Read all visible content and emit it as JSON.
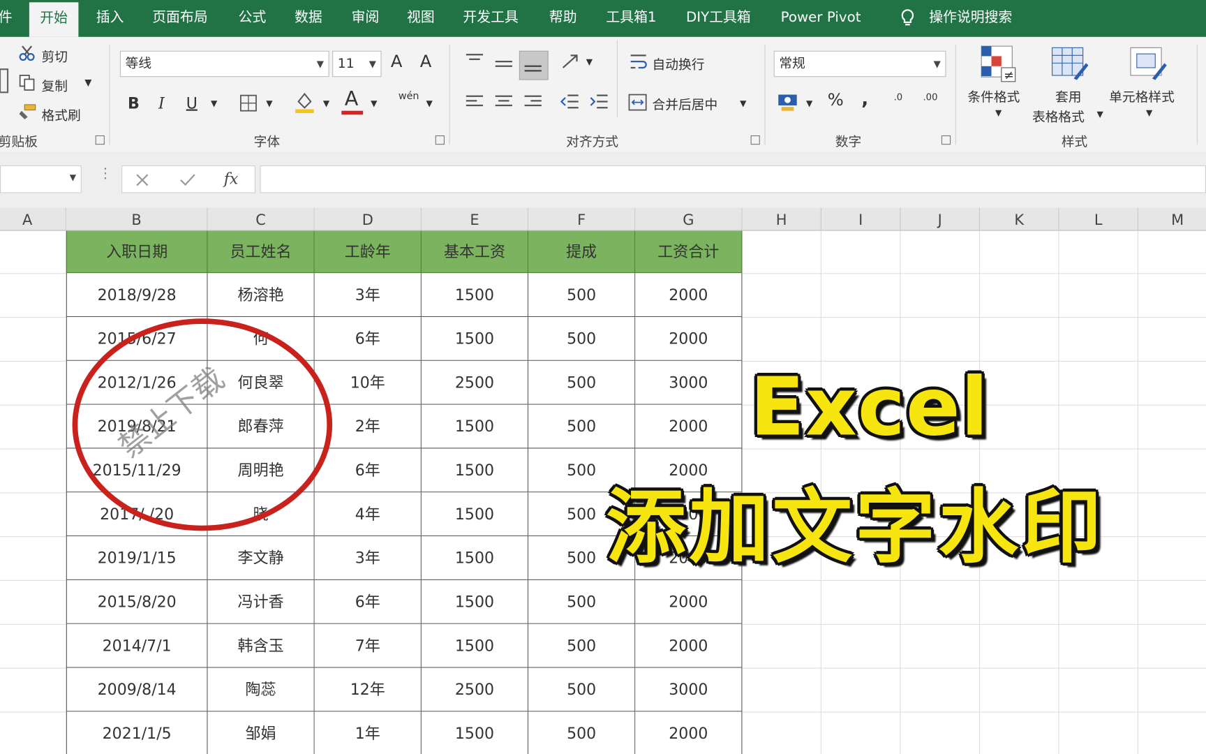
{
  "menu": {
    "file_partial": "件",
    "tabs": [
      "开始",
      "插入",
      "页面布局",
      "公式",
      "数据",
      "审阅",
      "视图",
      "开发工具",
      "帮助",
      "工具箱1",
      "DIY工具箱",
      "Power Pivot"
    ],
    "search": "操作说明搜索"
  },
  "ribbon": {
    "clipboard": {
      "cut": "剪切",
      "copy": "复制",
      "painter": "格式刷",
      "label": "剪贴板"
    },
    "font": {
      "name": "等线",
      "size": "11",
      "bold": "B",
      "italic": "I",
      "underline": "U",
      "grow": "A",
      "shrink": "A",
      "color_a": "A",
      "phonetic": "wén",
      "label": "字体",
      "font_color": "#e02020",
      "fill_color": "#f5c518"
    },
    "align": {
      "wrap": "自动换行",
      "merge": "合并后居中",
      "label": "对齐方式"
    },
    "number": {
      "format": "常规",
      "percent": "%",
      "comma": ",",
      "inc": ".0",
      "dec": ".00",
      "label": "数字"
    },
    "styles": {
      "conditional": "条件格式",
      "table_1": "套用",
      "table_2": "表格格式",
      "cell": "单元格样式",
      "label": "样式"
    }
  },
  "formula_bar": {
    "fx": "fx"
  },
  "columns": [
    "A",
    "B",
    "C",
    "D",
    "E",
    "F",
    "G",
    "H",
    "I",
    "J",
    "K",
    "L",
    "M"
  ],
  "table": {
    "headers": [
      "入职日期",
      "员工姓名",
      "工龄年",
      "基本工资",
      "提成",
      "工资合计"
    ],
    "rows": [
      [
        "2018/9/28",
        "杨溶艳",
        "3年",
        "1500",
        "500",
        "2000"
      ],
      [
        "2015/6/27",
        "何  ",
        "6年",
        "1500",
        "500",
        "2000"
      ],
      [
        "2012/1/26",
        "何良翠",
        "10年",
        "2500",
        "500",
        "3000"
      ],
      [
        "2019/8/21",
        "郎春萍",
        "2年",
        "1500",
        "500",
        "2000"
      ],
      [
        "2015/11/29",
        "周明艳",
        "6年",
        "1500",
        "500",
        "2000"
      ],
      [
        "2017/ /20",
        "晓 ",
        "4年",
        "1500",
        "500",
        "2000"
      ],
      [
        "2019/1/15",
        "李文静",
        "3年",
        "1500",
        "500",
        "2000"
      ],
      [
        "2015/8/20",
        "冯计香",
        "6年",
        "1500",
        "500",
        "2000"
      ],
      [
        "2014/7/1",
        "韩含玉",
        "7年",
        "1500",
        "500",
        "2000"
      ],
      [
        "2009/8/14",
        "陶蕊",
        "12年",
        "2500",
        "500",
        "3000"
      ],
      [
        "2021/1/5",
        "邹娟",
        "1年",
        "1500",
        "500",
        "2000"
      ]
    ]
  },
  "watermark": "禁止下载",
  "overlay": {
    "line1": "Excel",
    "line2": "添加文字水印"
  }
}
